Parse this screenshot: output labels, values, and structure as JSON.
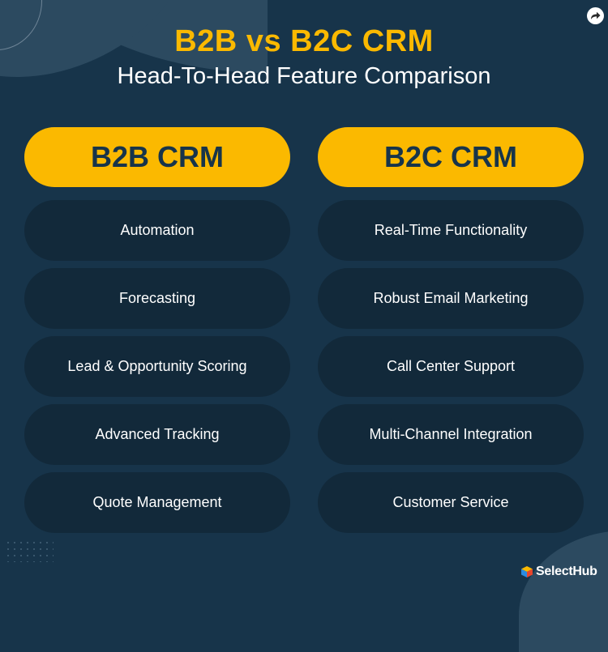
{
  "header": {
    "title": "B2B vs B2C CRM",
    "subtitle": "Head-To-Head Feature Comparison"
  },
  "columns": [
    {
      "heading": "B2B CRM",
      "items": [
        "Automation",
        "Forecasting",
        "Lead & Opportunity Scoring",
        "Advanced Tracking",
        "Quote Management"
      ]
    },
    {
      "heading": "B2C CRM",
      "items": [
        "Real-Time Functionality",
        "Robust Email Marketing",
        "Call Center Support",
        "Multi-Channel Integration",
        "Customer Service"
      ]
    }
  ],
  "brand": {
    "logo_text": "SelectHub",
    "accent_color": "#fbb900",
    "background_color": "#17344a",
    "pill_color": "#12293a"
  },
  "icons": {
    "share": "share-icon",
    "logo": "selecthub-cube-icon"
  }
}
